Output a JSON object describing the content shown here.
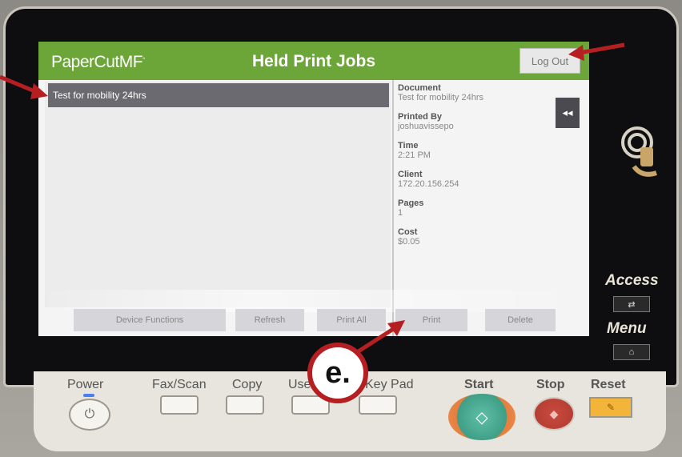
{
  "screen": {
    "logo": "PaperCut",
    "logo_suffix": "MF",
    "title": "Held Print Jobs",
    "logout_label": "Log Out",
    "collapse_label": "◂◂",
    "jobs": [
      {
        "name": "Test for mobility 24hrs",
        "selected": true
      }
    ],
    "details": [
      {
        "label": "Document",
        "value": "Test for mobility 24hrs"
      },
      {
        "label": "Printed By",
        "value": "joshuavissepo"
      },
      {
        "label": "Time",
        "value": "2:21 PM"
      },
      {
        "label": "Client",
        "value": "172.20.156.254"
      },
      {
        "label": "Pages",
        "value": "1"
      },
      {
        "label": "Cost",
        "value": "$0.05"
      }
    ],
    "buttons": {
      "device_functions": "Device Functions",
      "refresh": "Refresh",
      "print_all": "Print All",
      "print": "Print",
      "delete": "Delete"
    }
  },
  "side": {
    "access": "Access",
    "menu": "Menu"
  },
  "panel": {
    "power": "Power",
    "fax_scan": "Fax/Scan",
    "copy": "Copy",
    "user": "User",
    "keypad": "Key Pad",
    "start": "Start",
    "stop": "Stop",
    "reset": "Reset"
  },
  "annotation": {
    "callout_label": "e.",
    "arrow_color": "#b51f22"
  },
  "colors": {
    "header_green": "#6ca538",
    "selected_row": "#6a6a70"
  }
}
